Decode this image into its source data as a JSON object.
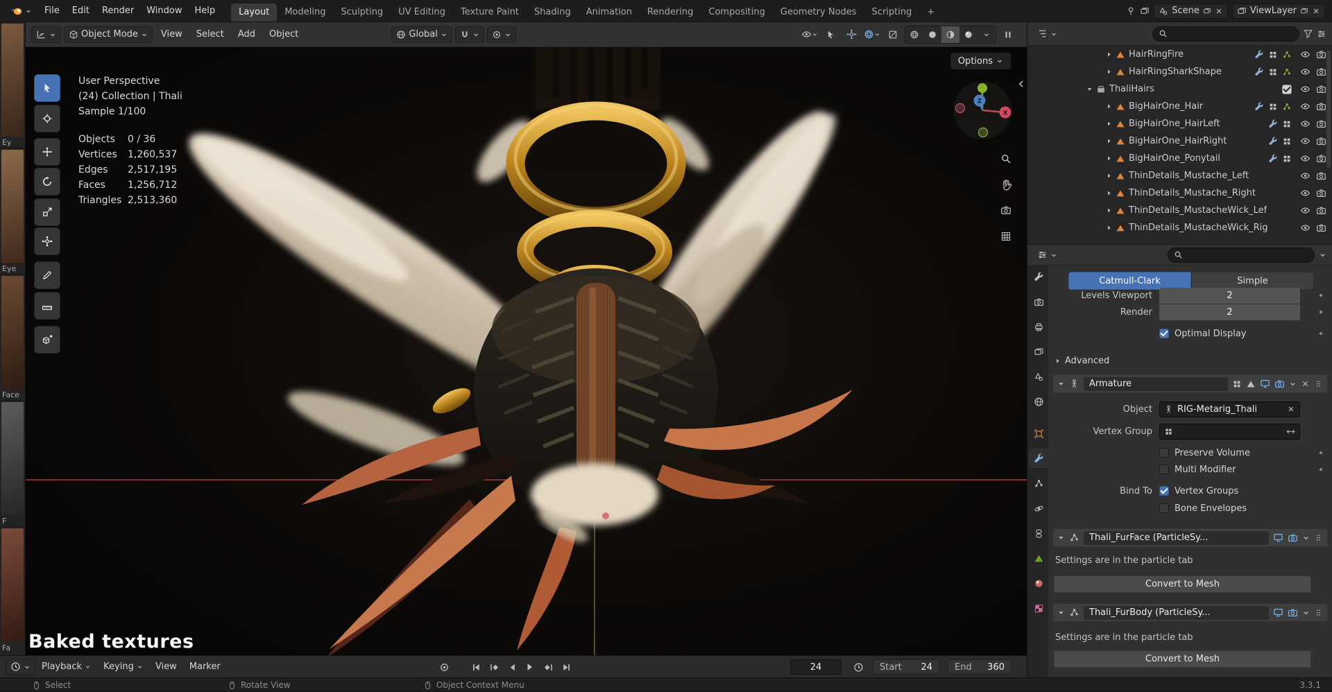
{
  "topbar": {
    "menus": [
      "File",
      "Edit",
      "Render",
      "Window",
      "Help"
    ],
    "workspaces": [
      "Layout",
      "Modeling",
      "Sculpting",
      "UV Editing",
      "Texture Paint",
      "Shading",
      "Animation",
      "Rendering",
      "Compositing",
      "Geometry Nodes",
      "Scripting"
    ],
    "add_tab": "+",
    "scene": "Scene",
    "viewlayer": "ViewLayer"
  },
  "viewport_header": {
    "mode": "Object Mode",
    "menus": [
      "View",
      "Select",
      "Add",
      "Object"
    ],
    "orientation": "Global"
  },
  "viewport": {
    "options": "Options",
    "overlay": [
      "User Perspective",
      "(24) Collection | Thali",
      "Sample 1/100"
    ],
    "stats": [
      {
        "label": "Objects",
        "value": "0 / 36"
      },
      {
        "label": "Vertices",
        "value": "1,260,537"
      },
      {
        "label": "Edges",
        "value": "2,517,195"
      },
      {
        "label": "Faces",
        "value": "1,256,712"
      },
      {
        "label": "Triangles",
        "value": "2,513,360"
      }
    ],
    "gizmo": {
      "x": "X",
      "z": "Z"
    },
    "caption": "Baked textures"
  },
  "left_strip": {
    "captions": [
      "Ey",
      "Eye",
      "Face",
      "F",
      "Fa"
    ]
  },
  "outliner": {
    "items": [
      {
        "label": "HairRingFire"
      },
      {
        "label": "HairRingSharkShape"
      },
      {
        "label": "ThaliHairs"
      },
      {
        "label": "BigHairOne_Hair"
      },
      {
        "label": "BigHairOne_HairLeft"
      },
      {
        "label": "BigHairOne_HairRight"
      },
      {
        "label": "BigHairOne_Ponytail"
      },
      {
        "label": "ThinDetails_Mustache_Left"
      },
      {
        "label": "ThinDetails_Mustache_Right"
      },
      {
        "label": "ThinDetails_MustacheWick_Lef"
      },
      {
        "label": "ThinDetails_MustacheWick_Rig"
      }
    ]
  },
  "properties": {
    "subdivision": {
      "type_catmull": "Catmull-Clark",
      "type_simple": "Simple",
      "levels_label": "Levels Viewport",
      "levels_value": "2",
      "render_label": "Render",
      "render_value": "2",
      "optimal_display": "Optimal Display",
      "advanced": "Advanced"
    },
    "armature": {
      "name": "Armature",
      "object_label": "Object",
      "object_value": "RIG-Metarig_Thali",
      "vertex_group_label": "Vertex Group",
      "preserve_volume": "Preserve Volume",
      "multi_modifier": "Multi Modifier",
      "bind_to_label": "Bind To",
      "vertex_groups": "Vertex Groups",
      "bone_envelopes": "Bone Envelopes"
    },
    "fur_face": {
      "name": "Thali_FurFace (ParticleSy...",
      "info": "Settings are in the particle tab",
      "convert": "Convert to Mesh"
    },
    "fur_body": {
      "name": "Thali_FurBody (ParticleSy...",
      "info": "Settings are in the particle tab",
      "convert": "Convert to Mesh"
    }
  },
  "timeline": {
    "menus": [
      "Playback",
      "Keying",
      "View",
      "Marker"
    ],
    "current_frame": "24",
    "start_label": "Start",
    "start_value": "24",
    "end_label": "End",
    "end_value": "360"
  },
  "statusbar": {
    "hints": [
      "Select",
      "Rotate View",
      "Object Context Menu"
    ],
    "version": "3.3.1"
  }
}
